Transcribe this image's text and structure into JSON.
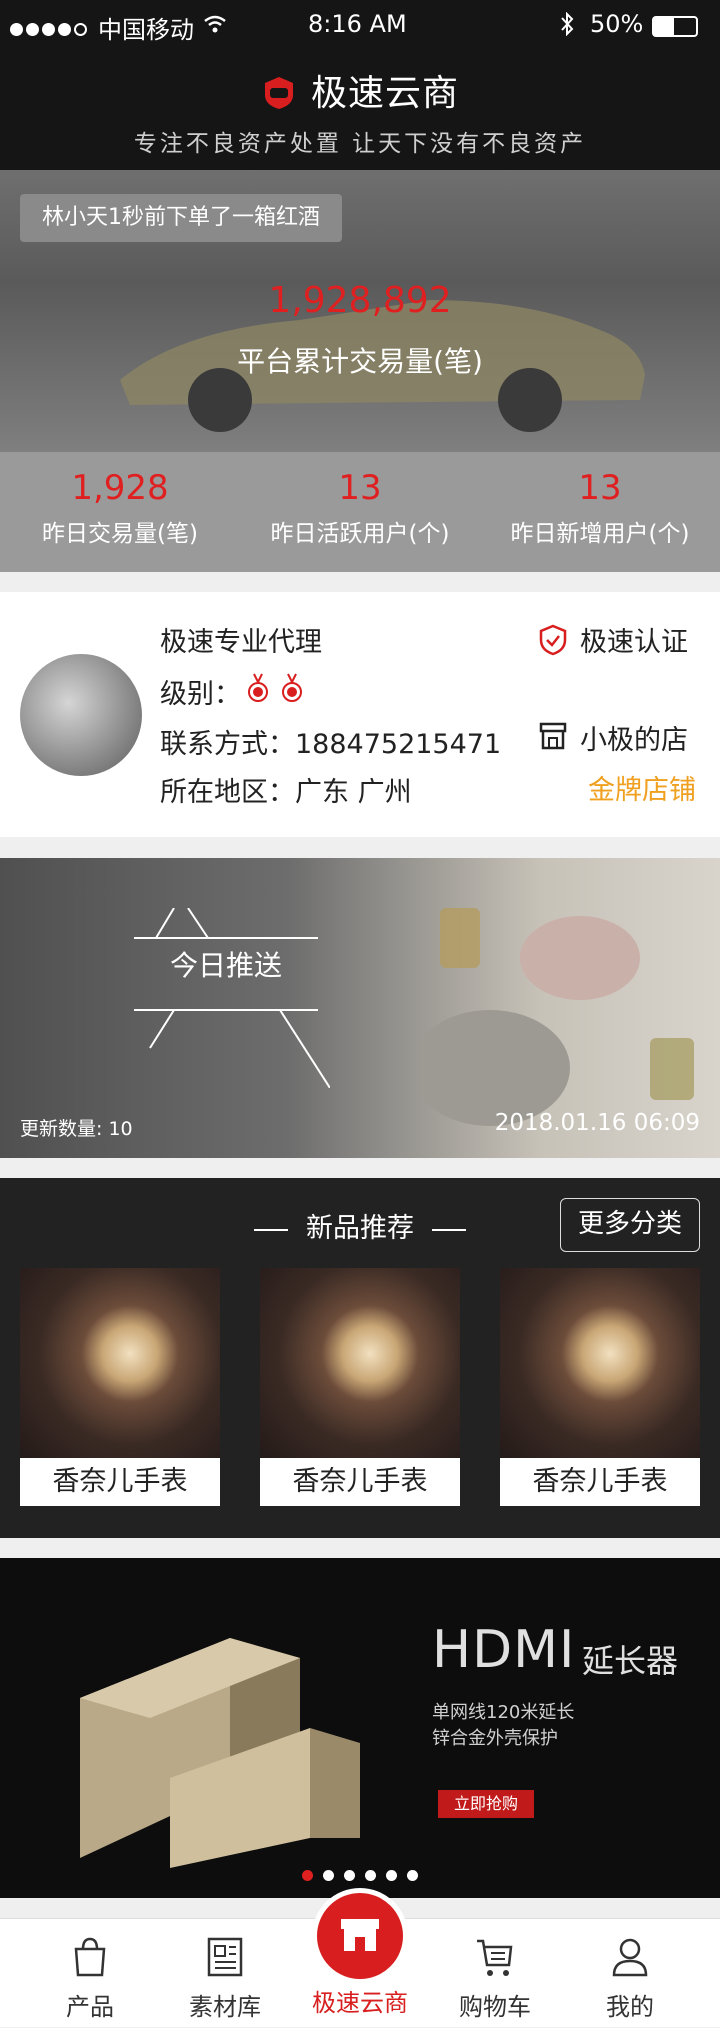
{
  "status_bar": {
    "carrier": "中国移动",
    "time": "8:16 AM",
    "battery": "50%"
  },
  "header": {
    "title": "极速云商",
    "subtitle": "专注不良资产处置 让天下没有不良资产"
  },
  "hero": {
    "ticker": "林小天1秒前下单了一箱红酒",
    "total_value": "1,928,892",
    "total_label": "平台累计交易量(笔)",
    "stats": [
      {
        "value": "1,928",
        "label": "昨日交易量(笔)"
      },
      {
        "value": "13",
        "label": "昨日活跃用户(个)"
      },
      {
        "value": "13",
        "label": "昨日新增用户(个)"
      }
    ]
  },
  "profile": {
    "name": "极速专业代理",
    "level_label": "级别：",
    "contact": "联系方式：18847521547​1",
    "region": "所在地区：广东 广州",
    "cert": "极速认证",
    "shop": "小极的店",
    "shop_tier": "金牌店铺"
  },
  "push": {
    "label": "今日推送",
    "update_count": "更新数量: 10",
    "date": "2018.01.16  06:09"
  },
  "new_products": {
    "title": "新品推荐",
    "more": "更多分类",
    "items": [
      {
        "name": "香奈儿手表"
      },
      {
        "name": "香奈儿手表"
      },
      {
        "name": "香奈儿手表"
      }
    ]
  },
  "banner": {
    "title": "HDMI",
    "title_suffix": "延长器",
    "line1": "单网线120米延长",
    "line2": "锌合金外壳保护",
    "button": "立即抢购"
  },
  "tabs": [
    {
      "label": "产品",
      "icon": "bag-icon"
    },
    {
      "label": "素材库",
      "icon": "newspaper-icon"
    },
    {
      "label": "极速云商",
      "icon": "store-icon"
    },
    {
      "label": "购物车",
      "icon": "cart-icon"
    },
    {
      "label": "我的",
      "icon": "user-icon"
    }
  ],
  "colors": {
    "accent": "#e02020",
    "gold": "#f0a020",
    "dark": "#151515"
  }
}
